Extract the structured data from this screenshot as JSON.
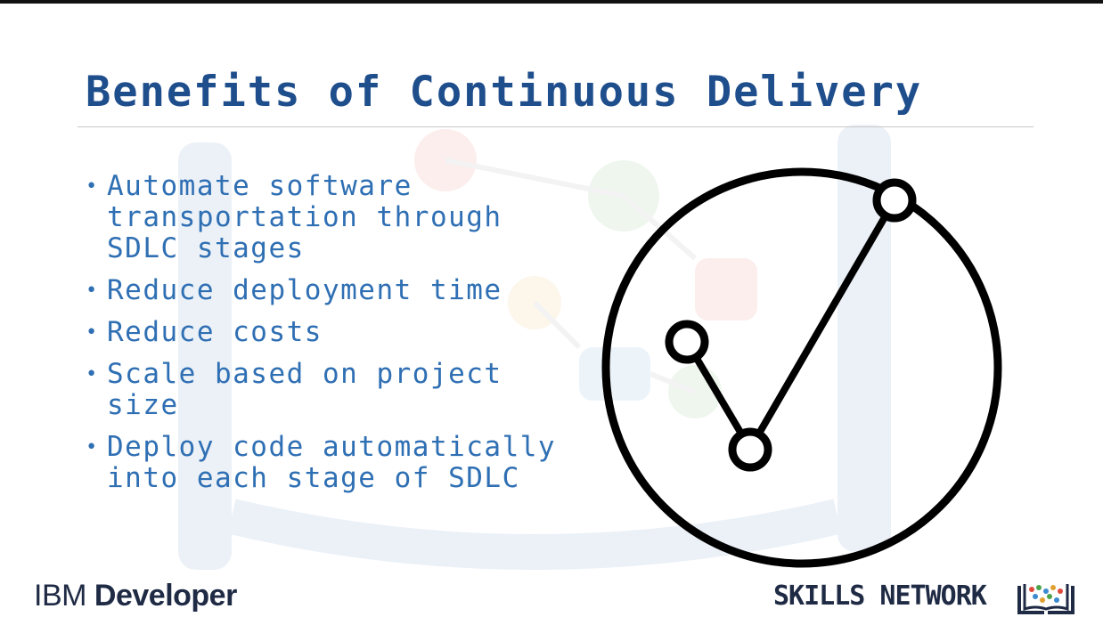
{
  "slide": {
    "title": "Benefits of Continuous Delivery",
    "bullet_glyph": "•",
    "bullets": [
      "Automate software transportation through SDLC stages",
      "Reduce deployment time",
      "Reduce costs",
      "Scale based on project size",
      "Deploy code automatically into each stage of SDLC"
    ]
  },
  "footer": {
    "ibm_prefix": "IBM",
    "ibm_name": "Developer",
    "skills_network": "SKILLS NETWORK"
  },
  "icons": {
    "main_graphic": "checkmark-circle-icon",
    "footer_logo": "book-icon"
  },
  "colors": {
    "title": "#1f4e8c",
    "bullet_text": "#2f6fb3",
    "logo_text": "#1f2a44",
    "graphic_stroke": "#000000"
  }
}
